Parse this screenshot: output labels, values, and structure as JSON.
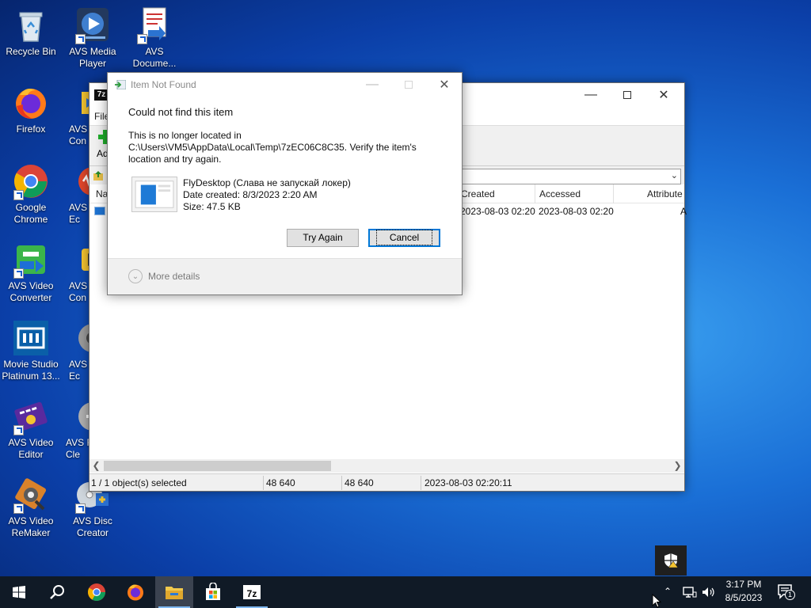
{
  "desktop": {
    "icons": [
      {
        "label": "Recycle Bin",
        "icon": "recycle-bin-icon"
      },
      {
        "label": "AVS Media Player",
        "icon": "avs-media-player-icon"
      },
      {
        "label": "AVS Docume...",
        "icon": "avs-document-converter-icon"
      },
      {
        "label": "Firefox",
        "icon": "firefox-icon"
      },
      {
        "label": "Google Chrome",
        "icon": "chrome-icon"
      },
      {
        "label": "AVS Video Converter",
        "icon": "avs-video-converter-icon"
      },
      {
        "label": "Movie Studio Platinum 13...",
        "icon": "movie-studio-icon"
      },
      {
        "label": "AVS Video Editor",
        "icon": "avs-video-editor-icon"
      },
      {
        "label": "AVS Video ReMaker",
        "icon": "avs-video-remaker-icon"
      },
      {
        "label": "AVS Disc Creator",
        "icon": "avs-disc-creator-icon"
      }
    ],
    "partial_labels": [
      "AVS",
      "Con",
      "AVS",
      "Ec",
      "AVS",
      "Con",
      "AVS",
      "Ec",
      "AVS F",
      "Cle"
    ]
  },
  "zip_window": {
    "menu_partial": "File",
    "toolbar_partial": "Ad",
    "columns": [
      "Na",
      "Created",
      "Accessed",
      "Attribute"
    ],
    "row": {
      "created": "2023-08-03 02:20",
      "accessed": "2023-08-03 02:20",
      "attr": "A"
    },
    "status": {
      "selection": "1 / 1 object(s) selected",
      "size": "48 640",
      "packed": "48 640",
      "modified": "2023-08-03 02:20:11"
    }
  },
  "dialog": {
    "title": "Item Not Found",
    "heading": "Could not find this item",
    "message": "This is no longer located in C:\\Users\\VM5\\AppData\\Local\\Temp\\7zEC06C8C35. Verify the item's location and try again.",
    "file_name": "FlyDesktop (Слава не запускай локер)",
    "date_created": "Date created: 8/3/2023 2:20 AM",
    "size": "Size: 47.5 KB",
    "try_again_label": "Try Again",
    "cancel_label": "Cancel",
    "more_details_label": "More details"
  },
  "taskbar": {
    "items": [
      "start-icon",
      "search-icon",
      "chrome-icon",
      "firefox-icon",
      "file-explorer-icon",
      "store-icon",
      "7zip-icon"
    ],
    "time": "3:17 PM",
    "date": "8/5/2023",
    "notification_count": "1"
  },
  "colors": {
    "accent": "#0078d7",
    "taskbar": "#101a26"
  }
}
